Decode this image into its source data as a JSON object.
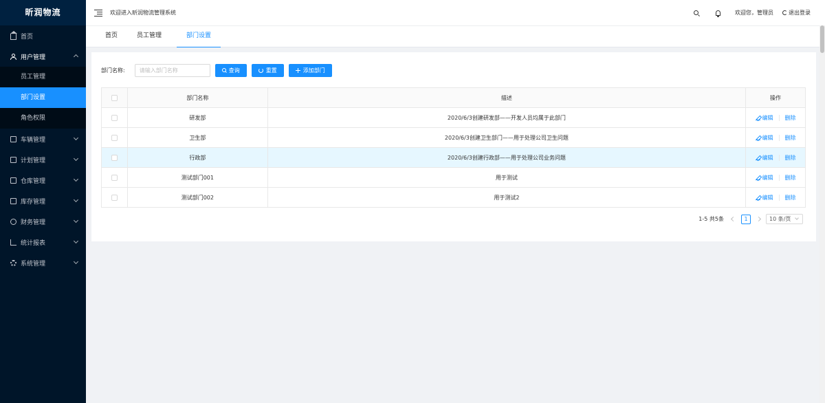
{
  "app": {
    "logo": "昕润物流"
  },
  "sidebar": {
    "home": "首页",
    "user_mgmt": "用户管理",
    "sub": [
      "员工管理",
      "部门设置",
      "角色权限"
    ],
    "items": [
      "车辆管理",
      "计划管理",
      "仓库管理",
      "库存管理",
      "财务管理",
      "统计报表",
      "系统管理"
    ]
  },
  "header": {
    "welcome": "欢迎进入昕润物流管理系统",
    "user": "欢迎您，管理员",
    "logout": "退出登录"
  },
  "tabs": [
    "首页",
    "员工管理",
    "部门设置"
  ],
  "filter": {
    "label": "部门名称:",
    "placeholder": "请输入部门名称",
    "search": "查询",
    "reset": "重置",
    "add": "添加部门"
  },
  "table": {
    "headers": {
      "name": "部门名称",
      "desc": "描述",
      "ops": "操作"
    },
    "rows": [
      {
        "name": "研发部",
        "desc": "2020/6/3创建研发部——开发人员均属于此部门"
      },
      {
        "name": "卫生部",
        "desc": "2020/6/3创建卫生部门——用于处理公司卫生问题"
      },
      {
        "name": "行政部",
        "desc": "2020/6/3创建行政部——用于处理公司业务问题"
      },
      {
        "name": "测试部门001",
        "desc": "用于测试"
      },
      {
        "name": "测试部门002",
        "desc": "用于测试2"
      }
    ],
    "edit": "编辑",
    "delete": "删除"
  },
  "pager": {
    "total": "1-5 共5条",
    "page": "1",
    "size": "10 条/页"
  },
  "colors": {
    "primary": "#1890ff",
    "sidebar": "#001529"
  }
}
